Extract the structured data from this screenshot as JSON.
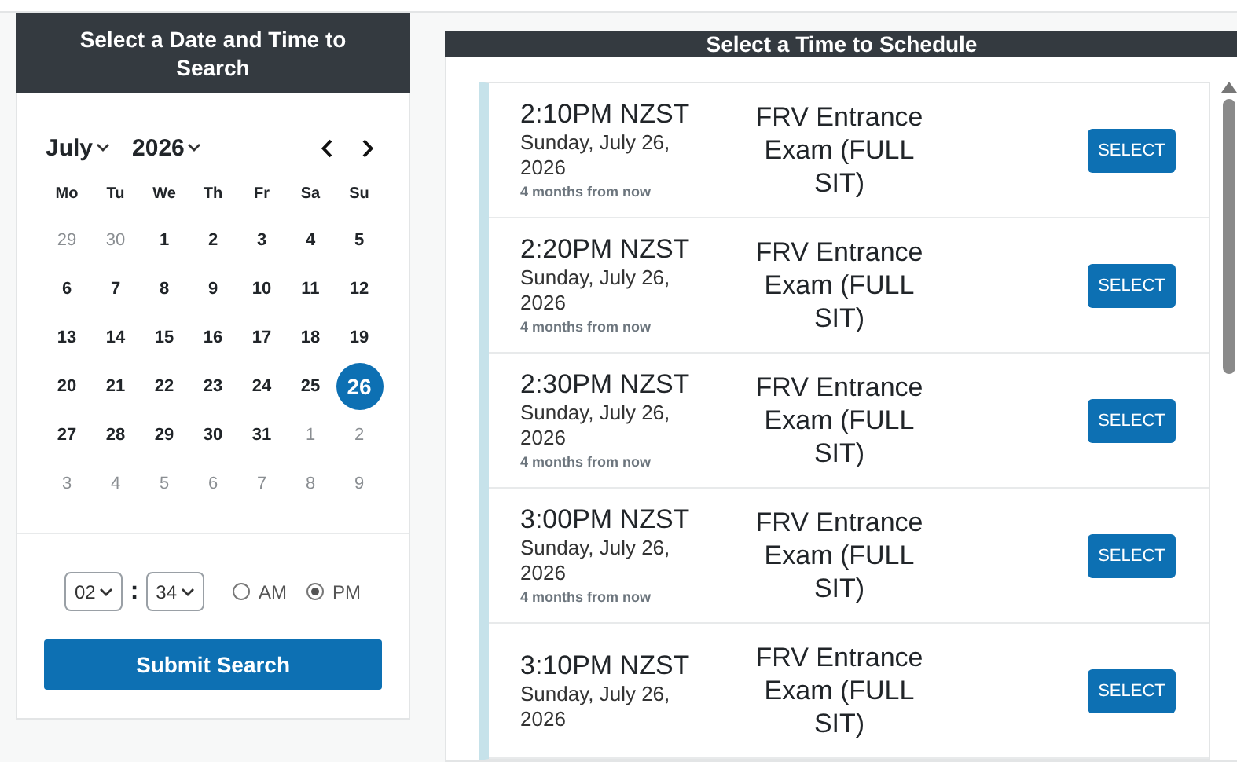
{
  "search_panel": {
    "title": "Select a Date and Time to Search",
    "month": "July",
    "year": "2026",
    "weekdays": [
      "Mo",
      "Tu",
      "We",
      "Th",
      "Fr",
      "Sa",
      "Su"
    ],
    "weeks": [
      [
        {
          "label": "29",
          "muted": true,
          "selected": false
        },
        {
          "label": "30",
          "muted": true,
          "selected": false
        },
        {
          "label": "1",
          "muted": false,
          "selected": false
        },
        {
          "label": "2",
          "muted": false,
          "selected": false
        },
        {
          "label": "3",
          "muted": false,
          "selected": false
        },
        {
          "label": "4",
          "muted": false,
          "selected": false
        },
        {
          "label": "5",
          "muted": false,
          "selected": false
        }
      ],
      [
        {
          "label": "6",
          "muted": false,
          "selected": false
        },
        {
          "label": "7",
          "muted": false,
          "selected": false
        },
        {
          "label": "8",
          "muted": false,
          "selected": false
        },
        {
          "label": "9",
          "muted": false,
          "selected": false
        },
        {
          "label": "10",
          "muted": false,
          "selected": false
        },
        {
          "label": "11",
          "muted": false,
          "selected": false
        },
        {
          "label": "12",
          "muted": false,
          "selected": false
        }
      ],
      [
        {
          "label": "13",
          "muted": false,
          "selected": false
        },
        {
          "label": "14",
          "muted": false,
          "selected": false
        },
        {
          "label": "15",
          "muted": false,
          "selected": false
        },
        {
          "label": "16",
          "muted": false,
          "selected": false
        },
        {
          "label": "17",
          "muted": false,
          "selected": false
        },
        {
          "label": "18",
          "muted": false,
          "selected": false
        },
        {
          "label": "19",
          "muted": false,
          "selected": false
        }
      ],
      [
        {
          "label": "20",
          "muted": false,
          "selected": false
        },
        {
          "label": "21",
          "muted": false,
          "selected": false
        },
        {
          "label": "22",
          "muted": false,
          "selected": false
        },
        {
          "label": "23",
          "muted": false,
          "selected": false
        },
        {
          "label": "24",
          "muted": false,
          "selected": false
        },
        {
          "label": "25",
          "muted": false,
          "selected": false
        },
        {
          "label": "26",
          "muted": false,
          "selected": true
        }
      ],
      [
        {
          "label": "27",
          "muted": false,
          "selected": false
        },
        {
          "label": "28",
          "muted": false,
          "selected": false
        },
        {
          "label": "29",
          "muted": false,
          "selected": false
        },
        {
          "label": "30",
          "muted": false,
          "selected": false
        },
        {
          "label": "31",
          "muted": false,
          "selected": false
        },
        {
          "label": "1",
          "muted": true,
          "selected": false
        },
        {
          "label": "2",
          "muted": true,
          "selected": false
        }
      ],
      [
        {
          "label": "3",
          "muted": true,
          "selected": false
        },
        {
          "label": "4",
          "muted": true,
          "selected": false
        },
        {
          "label": "5",
          "muted": true,
          "selected": false
        },
        {
          "label": "6",
          "muted": true,
          "selected": false
        },
        {
          "label": "7",
          "muted": true,
          "selected": false
        },
        {
          "label": "8",
          "muted": true,
          "selected": false
        },
        {
          "label": "9",
          "muted": true,
          "selected": false
        }
      ]
    ],
    "hour": "02",
    "separator": ":",
    "minute": "34",
    "periods": [
      {
        "label": "AM",
        "selected": false
      },
      {
        "label": "PM",
        "selected": true
      }
    ],
    "submit": "Submit Search"
  },
  "results_panel": {
    "title": "Select a Time to Schedule",
    "slots": [
      {
        "time": "2:10PM NZST",
        "date": "Sunday, July 26, 2026",
        "relative": "4 months from now",
        "event": "FRV Entrance Exam (FULL SIT)",
        "action": "SELECT"
      },
      {
        "time": "2:20PM NZST",
        "date": "Sunday, July 26, 2026",
        "relative": "4 months from now",
        "event": "FRV Entrance Exam (FULL SIT)",
        "action": "SELECT"
      },
      {
        "time": "2:30PM NZST",
        "date": "Sunday, July 26, 2026",
        "relative": "4 months from now",
        "event": "FRV Entrance Exam (FULL SIT)",
        "action": "SELECT"
      },
      {
        "time": "3:00PM NZST",
        "date": "Sunday, July 26, 2026",
        "relative": "4 months from now",
        "event": "FRV Entrance Exam (FULL SIT)",
        "action": "SELECT"
      },
      {
        "time": "3:10PM NZST",
        "date": "Sunday, July 26, 2026",
        "event": "FRV Entrance Exam (FULL SIT)",
        "action": "SELECT"
      }
    ]
  }
}
